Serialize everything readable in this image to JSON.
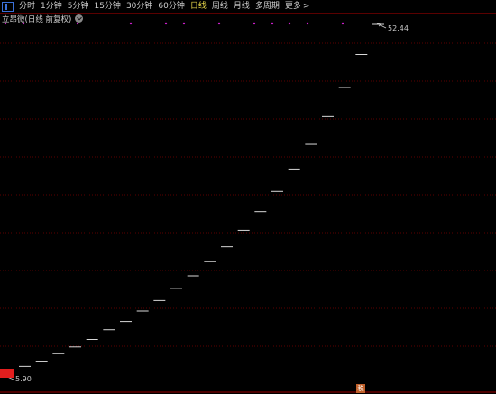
{
  "toolbar": {
    "periods": [
      "分时",
      "1分钟",
      "5分钟",
      "15分钟",
      "30分钟",
      "60分钟",
      "日线",
      "周线",
      "月线",
      "多周期"
    ],
    "active_period": "日线",
    "more_label": "更多"
  },
  "chart_title": "立昂微(日线 前复权)",
  "price_high_label": "52.44",
  "price_low_label": "5.90",
  "badge_text": "税",
  "colors": {
    "accent_active": "#e8d84a",
    "grid": "#7a0000",
    "dot": "#d020d0",
    "bar": "#d8d8d8",
    "block": "#e21e1e"
  },
  "chart_data": {
    "type": "line",
    "title": "立昂微(日线 前复权)",
    "xlabel": "",
    "ylabel": "",
    "ylim": [
      5.9,
      52.44
    ],
    "values": [
      6.7,
      7.4,
      8.4,
      9.3,
      10.3,
      11.6,
      12.7,
      14.1,
      15.5,
      17.1,
      18.8,
      20.7,
      22.7,
      24.9,
      27.4,
      30.1,
      33.1,
      36.4,
      40.1,
      44.0,
      48.4,
      52.44
    ],
    "marker_count": 12,
    "annotations": [
      "52.44",
      "5.90"
    ]
  }
}
